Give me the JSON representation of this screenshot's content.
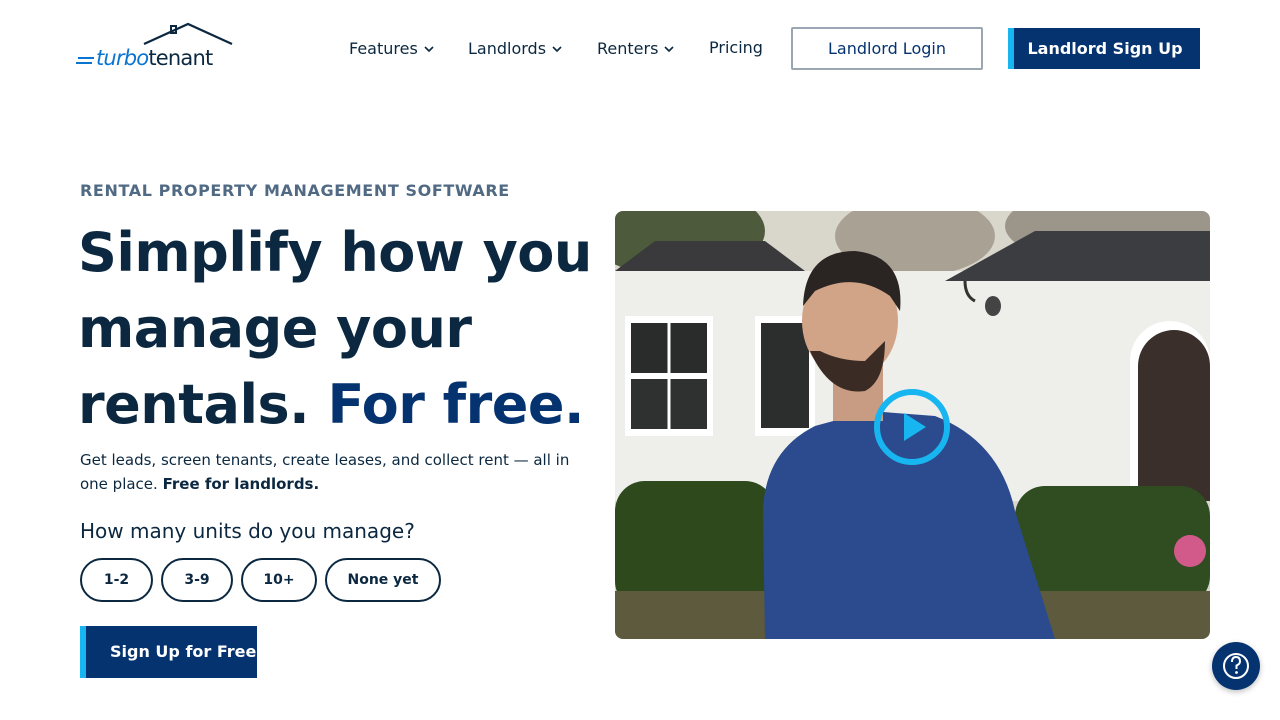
{
  "brand": {
    "logo_part1": "turbo",
    "logo_part2": "tenant"
  },
  "nav": {
    "items": [
      {
        "label": "Features",
        "has_dropdown": true
      },
      {
        "label": "Landlords",
        "has_dropdown": true
      },
      {
        "label": "Renters",
        "has_dropdown": true
      },
      {
        "label": "Pricing",
        "has_dropdown": false
      }
    ],
    "login_label": "Landlord Login",
    "signup_label": "Landlord Sign Up"
  },
  "hero": {
    "eyebrow": "RENTAL PROPERTY MANAGEMENT SOFTWARE",
    "headline_main": "Simplify how you manage your rentals.",
    "headline_accent": "For free.",
    "subtext_main": "Get leads, screen tenants, create leases, and collect rent — all in one place.",
    "subtext_bold": "Free for landlords.",
    "units_question": "How many units do you manage?",
    "unit_options": [
      "1-2",
      "3-9",
      "10+",
      "None yet"
    ],
    "cta_label": "Sign Up for Free"
  },
  "video": {
    "play_icon": "play-icon"
  },
  "help": {
    "icon": "question-icon"
  },
  "colors": {
    "navy": "#053370",
    "text": "#0b2840",
    "accent_cyan": "#17b6f0",
    "logo_blue": "#0a75d1",
    "eyebrow": "#516a84"
  }
}
